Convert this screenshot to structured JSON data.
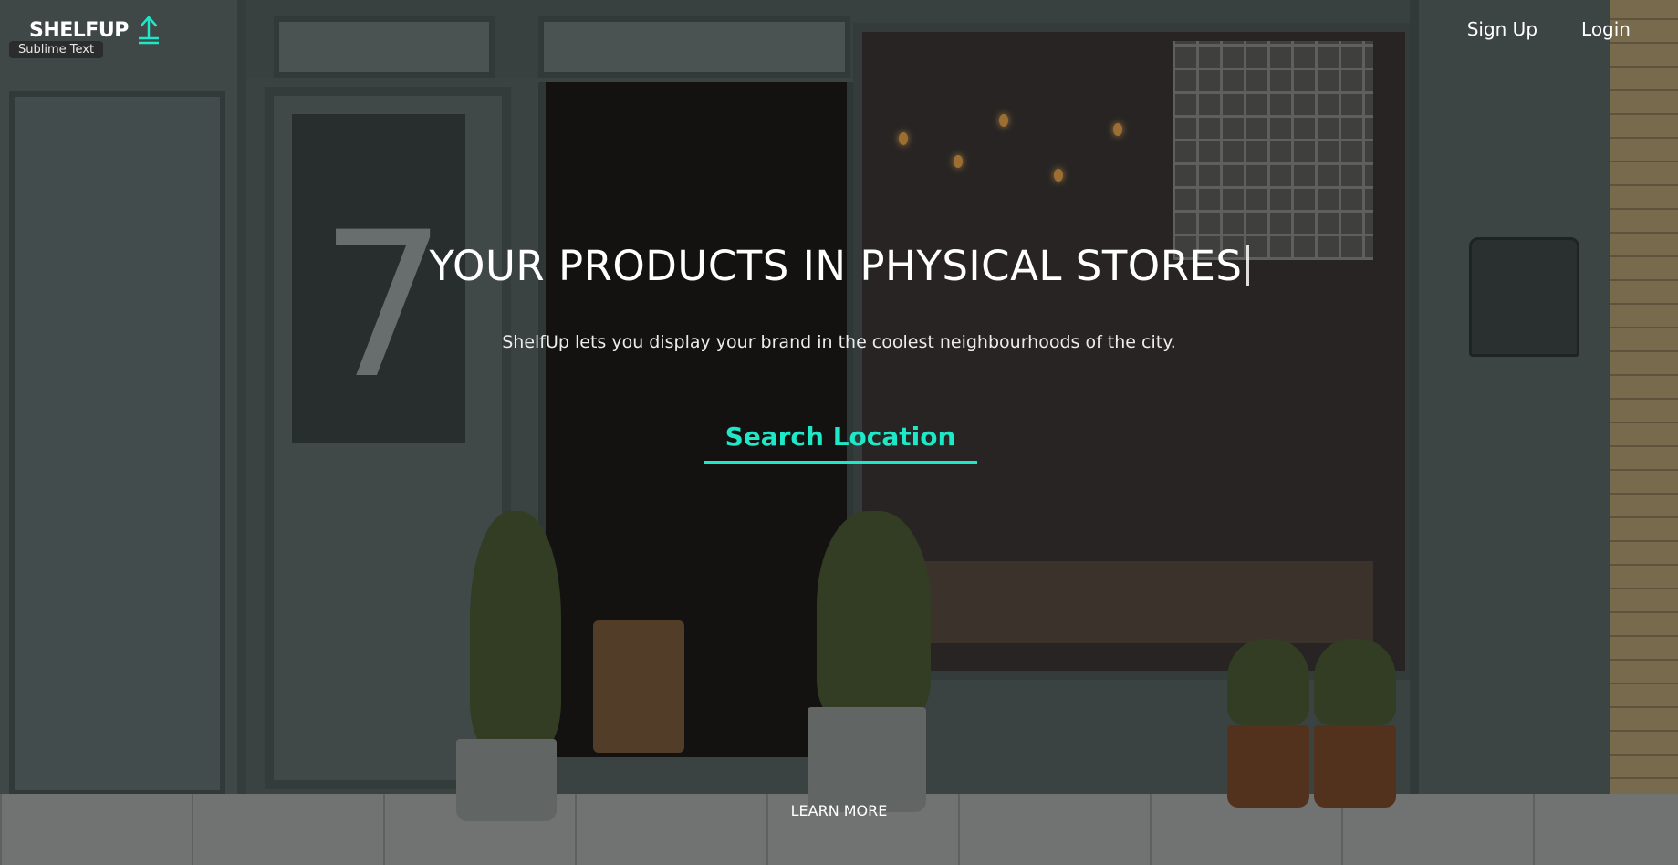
{
  "header": {
    "brand_name": "SHELFUP",
    "brand_icon": "upload-arrow-icon",
    "tooltip": "Sublime Text",
    "nav": [
      {
        "label": "Sign Up"
      },
      {
        "label": "Login"
      }
    ]
  },
  "hero": {
    "title": "YOUR PRODUCTS IN PHYSICAL STORES",
    "subtitle": "ShelfUp lets you display your brand in the coolest neighbourhoods of the city.",
    "search_label": "Search Location",
    "learn_more_label": "LEARN MORE"
  },
  "colors": {
    "accent": "#1de9c8",
    "text": "#ffffff"
  }
}
